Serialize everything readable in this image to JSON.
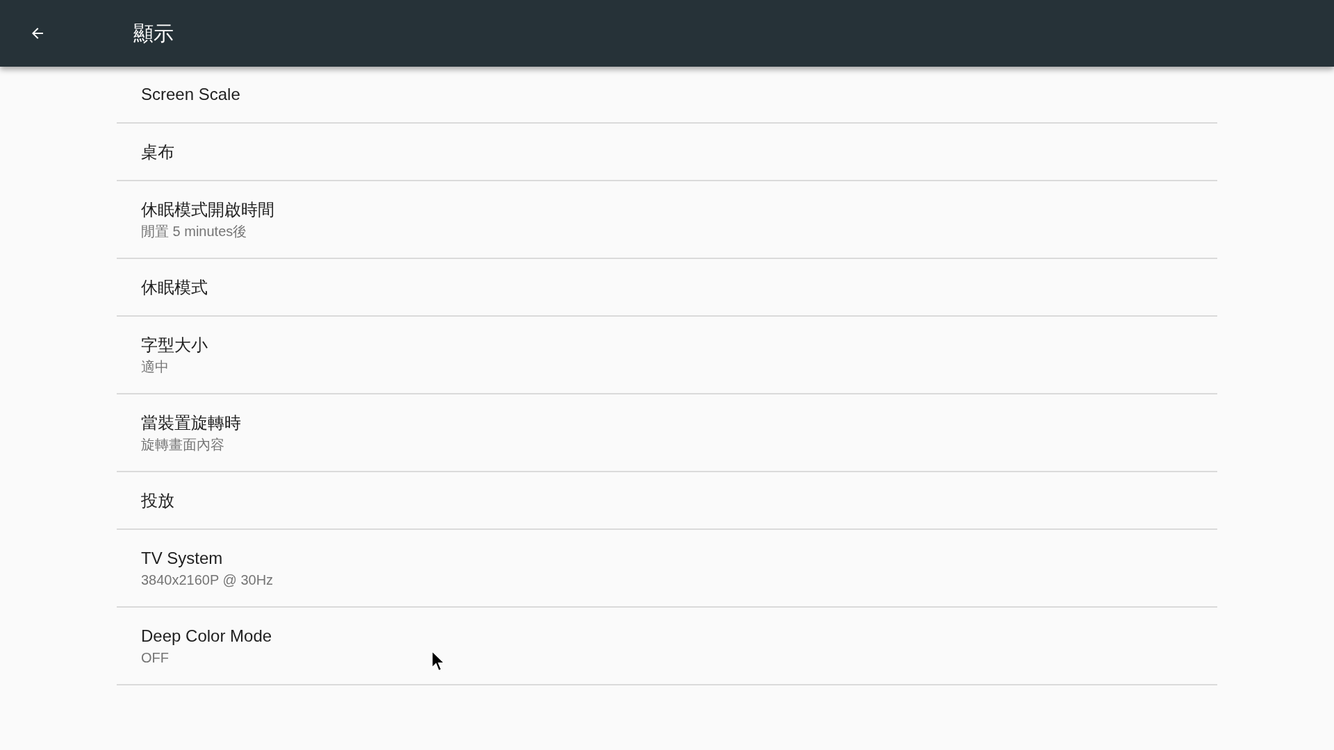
{
  "app_bar": {
    "title": "顯示"
  },
  "settings": [
    {
      "title": "Screen Scale"
    },
    {
      "title": "桌布"
    },
    {
      "title": "休眠模式開啟時間",
      "summary": "閒置 5 minutes後"
    },
    {
      "title": "休眠模式"
    },
    {
      "title": "字型大小",
      "summary": "適中"
    },
    {
      "title": "當裝置旋轉時",
      "summary": "旋轉畫面內容"
    },
    {
      "title": "投放"
    },
    {
      "title": "TV System",
      "summary": "3840x2160P @ 30Hz"
    },
    {
      "title": "Deep Color Mode",
      "summary": "OFF"
    }
  ]
}
